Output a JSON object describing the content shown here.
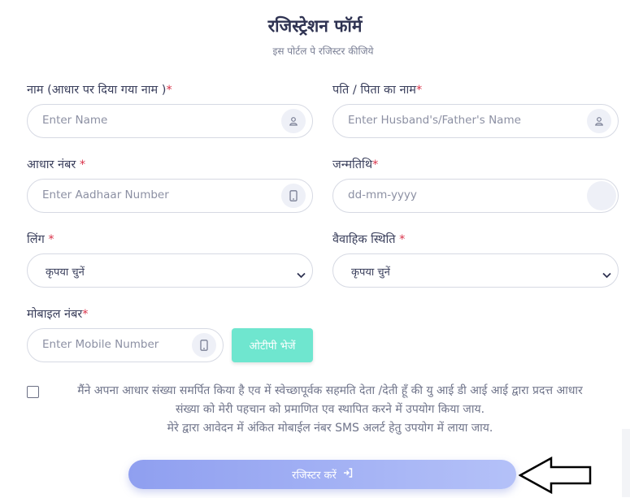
{
  "form": {
    "title": "रजिस्ट्रेशन फॉर्म",
    "subtitle": "इस पोर्टल पे रजिस्टर कीजिये"
  },
  "fields": {
    "name": {
      "label": "नाम (आधार पर दिया गया नाम )",
      "required_mark": "*",
      "placeholder": "Enter Name",
      "icon": "user-icon"
    },
    "guardian": {
      "label": "पति / पिता का नाम",
      "required_mark": "*",
      "placeholder": "Enter Husband's/Father's Name",
      "icon": "user-icon"
    },
    "aadhaar": {
      "label": "आधार नंबर ",
      "required_mark": "*",
      "placeholder": "Enter Aadhaar Number",
      "icon": "phone-icon"
    },
    "dob": {
      "label": "जन्मतिथि",
      "required_mark": "*",
      "placeholder": "dd-mm-yyyy",
      "icon": "calendar-icon"
    },
    "gender": {
      "label": "लिंग ",
      "required_mark": "*",
      "selected": "कृपया चुनें"
    },
    "marital": {
      "label": "वैवाहिक स्थिति ",
      "required_mark": "*",
      "selected": "कृपया चुनें"
    },
    "mobile": {
      "label": "मोबाइल नंबर",
      "required_mark": "*",
      "placeholder": "Enter Mobile Number",
      "icon": "phone-icon"
    }
  },
  "buttons": {
    "send_otp": "ओटीपी भेजें",
    "register": "रजिस्टर करें"
  },
  "consent": {
    "checked": false,
    "line1": "मैंने अपना आधार संख्या समर्पित किया है एव में स्वेच्छापूर्वक सहमति देता /देती हूँ की यु आई डी आई आई द्वारा प्रदत्त आधार",
    "line2": "संख्या को मेरी पहचान को प्रमाणित एव स्थापित करने में उपयोग किया जाय.",
    "line3": "मेरे द्वारा आवेदन में अंकित मोबाईल नंबर SMS अलर्ट हेतु उपयोग में लाया जाय."
  },
  "colors": {
    "accent_otp": "#6fe6cf",
    "register_gradient_start": "#8f9ff0",
    "required": "#d9334a"
  }
}
